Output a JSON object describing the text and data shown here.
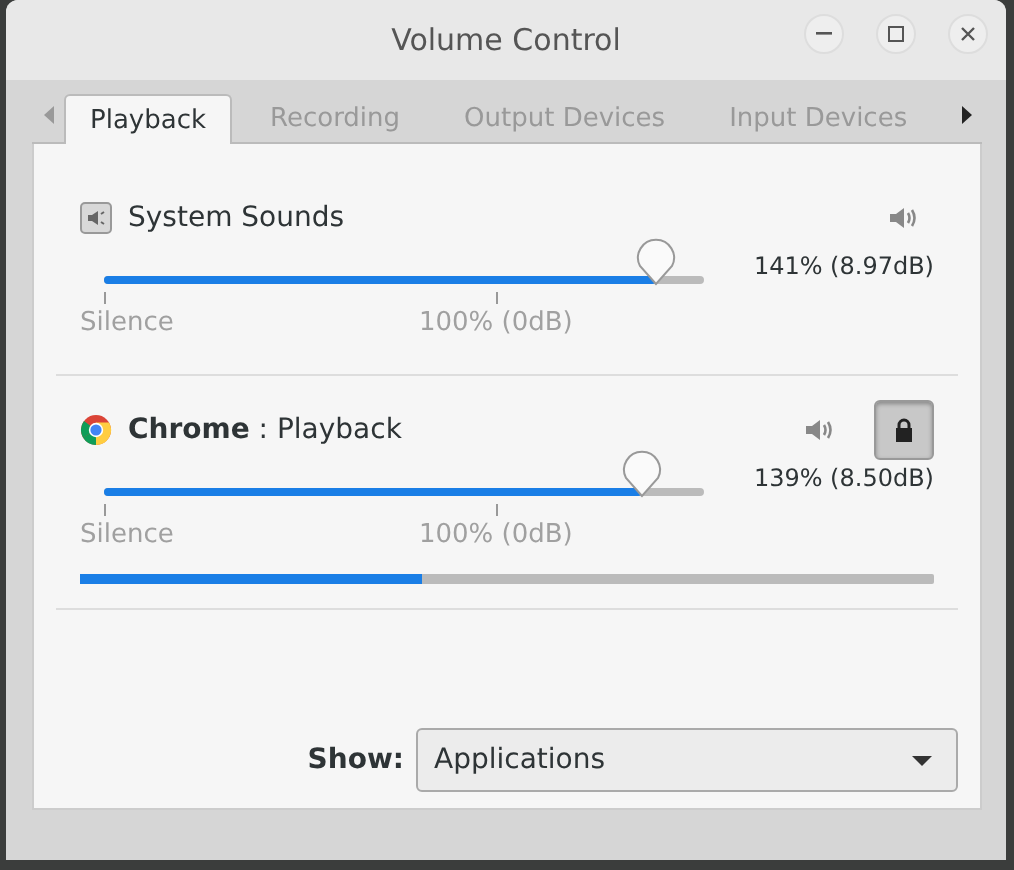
{
  "window": {
    "title": "Volume Control"
  },
  "tabs": [
    {
      "label": "Playback",
      "selected": true
    },
    {
      "label": "Recording",
      "selected": false
    },
    {
      "label": "Output Devices",
      "selected": false
    },
    {
      "label": "Input Devices",
      "selected": false
    }
  ],
  "streams": [
    {
      "kind": "system",
      "name": "System Sounds",
      "level": 0.92,
      "reading": "141% (8.97dB)",
      "marks": [
        "Silence",
        "100% (0dB)"
      ]
    },
    {
      "kind": "app",
      "name": "**Chrome** : Playback",
      "level": 0.897,
      "reading": "139% (8.50dB)",
      "marks": [
        "Silence",
        "100% (0dB)"
      ],
      "locked": true,
      "meter": {
        "level": 0.4
      }
    }
  ],
  "show": {
    "label": "Show:",
    "value": "Applications"
  }
}
